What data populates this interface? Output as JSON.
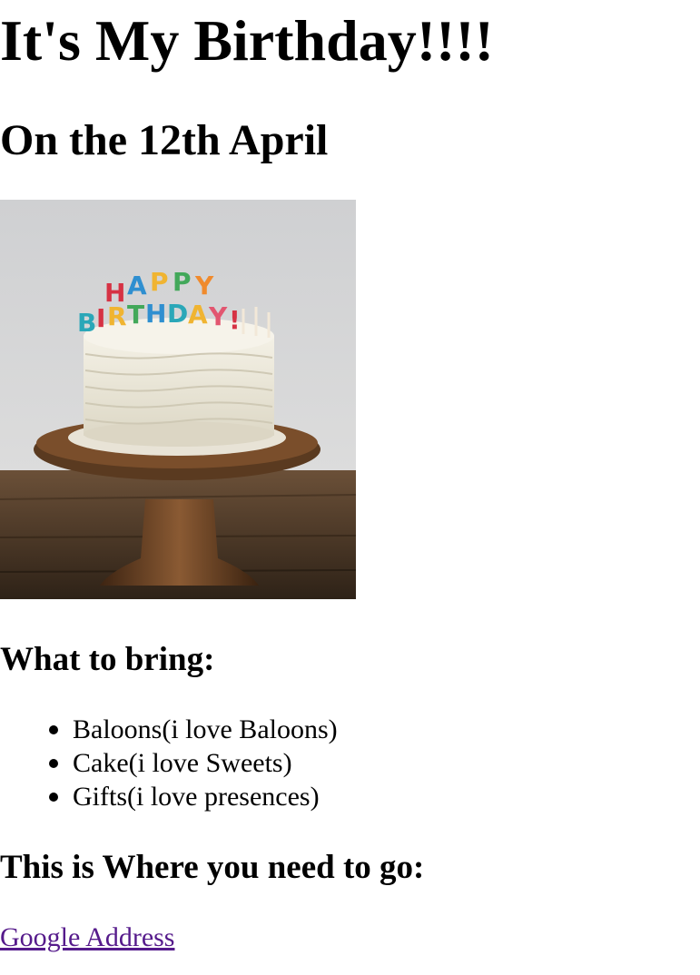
{
  "page": {
    "title": "It's My Birthday!!!!",
    "subtitle": "On the 12th April"
  },
  "image": {
    "description_icon": "birthday-cake-image",
    "candle_letters": [
      "H",
      "A",
      "P",
      "P",
      "Y",
      "B",
      "I",
      "R",
      "T",
      "H",
      "D",
      "A",
      "Y",
      "!"
    ]
  },
  "bring": {
    "heading": "What to bring:",
    "items": [
      "Baloons(i love Baloons)",
      "Cake(i love Sweets)",
      "Gifts(i love presences)"
    ]
  },
  "where": {
    "heading": "This is Where you need to go:",
    "link_label": "Google Address"
  },
  "colors": {
    "link_visited": "#551a8b",
    "text": "#000000",
    "background": "#ffffff"
  }
}
